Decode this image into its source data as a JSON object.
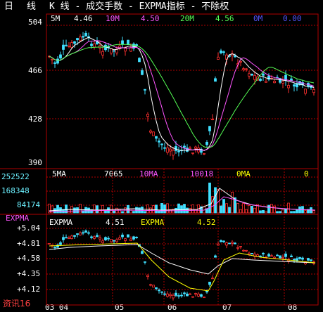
{
  "title": {
    "period_day": "日",
    "period_line": "线",
    "chart_kind": "K 线 - 成交手数 - EXPMA指标 - 不除权"
  },
  "price_panel": {
    "ma_labels": [
      {
        "label": "5M",
        "value": "4.46",
        "color": "#ffffff"
      },
      {
        "label": "10M",
        "value": "4.50",
        "color": "#ff55ff"
      },
      {
        "label": "20M",
        "value": "4.56",
        "color": "#55ff55"
      },
      {
        "label": "0M",
        "value": "0.00",
        "color": "#5555ff"
      }
    ],
    "y_ticks": [
      "504",
      "466",
      "428",
      "390"
    ]
  },
  "volume_panel": {
    "ma_labels": [
      {
        "label": "5MA",
        "value": "7065",
        "color": "#ffffff"
      },
      {
        "label": "10MA",
        "value": "10018",
        "color": "#ff55ff"
      },
      {
        "label": "0MA",
        "value": "0",
        "color": "#ffff00"
      }
    ],
    "y_ticks": [
      "252522",
      "168348",
      "84174"
    ]
  },
  "expma_panel": {
    "indicator_name": "EXPMA",
    "lines": [
      {
        "label": "EXPMA",
        "value": "4.51",
        "color": "#ffffff"
      },
      {
        "label": "EXPMA",
        "value": "4.52",
        "color": "#ffff00"
      }
    ],
    "y_ticks": [
      "+5.04",
      "+4.81",
      "+4.58",
      "+4.35",
      "+4.12"
    ]
  },
  "x_axis": {
    "dates": [
      "03 04",
      "05",
      "06",
      "07",
      "08"
    ]
  },
  "corner_label": "资讯16",
  "colors": {
    "background": "#000000",
    "grid": "#b00000",
    "up_candle": "#ff3030",
    "down_candle": "#40e0ff",
    "ma5": "#ffffff",
    "ma10": "#ff55ff",
    "ma20": "#55ff55"
  }
}
